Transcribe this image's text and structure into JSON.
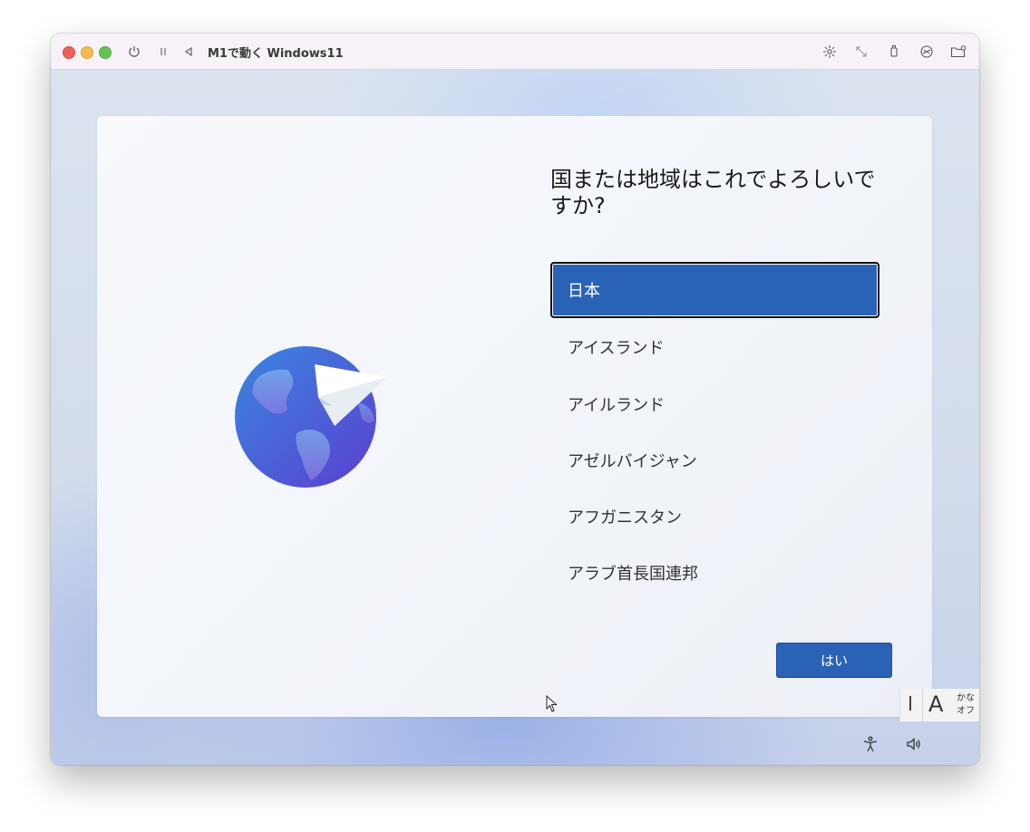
{
  "window": {
    "title": "M1で動く Windows11",
    "toolbar_icons": [
      "power-icon",
      "pause-icon",
      "back-icon",
      "brightness-icon",
      "resize-icon",
      "usb-icon",
      "network-icon",
      "folder-icon"
    ]
  },
  "setup": {
    "heading_line1": "国または地域はこれでよろしいで",
    "heading_line2": "すか?",
    "countries": [
      "日本",
      "アイスランド",
      "アイルランド",
      "アゼルバイジャン",
      "アフガニスタン",
      "アラブ首長国連邦"
    ],
    "selected_index": 0,
    "yes_button": "はい",
    "illustration": "globe-paper-plane-icon"
  },
  "ime": {
    "mode_letter": "A",
    "kana_line1": "かな",
    "kana_line2": "オフ"
  },
  "tray": {
    "icons": [
      "accessibility-icon",
      "volume-icon"
    ]
  },
  "colors": {
    "accent": "#2a63b6",
    "titlebar": "#f6f2f7"
  }
}
